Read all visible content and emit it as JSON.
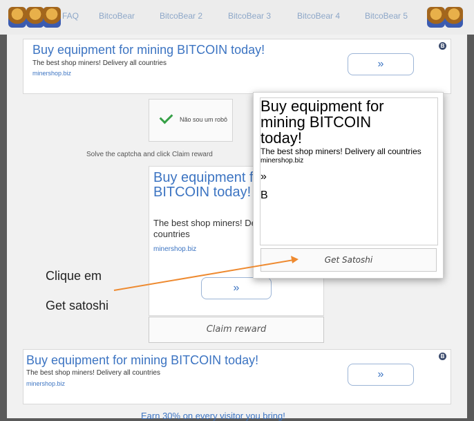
{
  "nav": {
    "items": [
      "FAQ",
      "BitcoBear",
      "BitcoBear 2",
      "BitcoBear 3",
      "BitcoBear 4",
      "BitcoBear 5"
    ]
  },
  "ad": {
    "title": "Buy equipment for mining BITCOIN today!",
    "desc": "The best shop miners! Delivery all countries",
    "url": "minershop.biz",
    "arrow": "»",
    "badge": "B"
  },
  "captcha": {
    "label": "Não sou um robô"
  },
  "hint": "Solve the captcha and click Claim reward",
  "claim_button": "Claim reward",
  "modal": {
    "button": "Get Satoshi"
  },
  "annotation": {
    "line1": "Clique em",
    "line2": "Get satoshi"
  },
  "footer_text": "Earn 30% on every visitor you bring!",
  "colors": {
    "link": "#3c74c2",
    "arrow": "#ee8a30"
  }
}
